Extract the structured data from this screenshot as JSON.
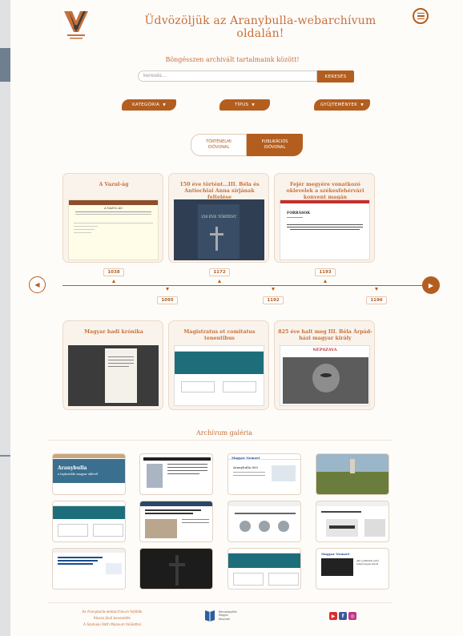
{
  "header": {
    "welcome": "Üdvözöljük az Aranybulla-webarchívum oldalán!"
  },
  "search": {
    "prompt": "Böngésszen archivált tartalmaink között!",
    "placeholder": "keresés...",
    "button_label": "KERESÉS"
  },
  "filters": [
    {
      "label": "KATEGÓRIA"
    },
    {
      "label": "TÍPUS"
    },
    {
      "label": "GYŰJTEMÉNYEK"
    }
  ],
  "timeline_toggle": {
    "option_a_line1": "TÖRTÉNELMI",
    "option_a_line2": "IDŐVONAL",
    "option_b_line1": "PUBLIKÁCIÓS",
    "option_b_line2": "IDŐVONAL",
    "active": "PUBLIKÁCIÓS IDŐVONAL"
  },
  "timeline": {
    "top_cards": [
      {
        "title": "A Vazul-ág",
        "year": "1038"
      },
      {
        "title": "150 éve történt...III. Béla és Antiochiai Anna sírjának feltelése",
        "year": "1172"
      },
      {
        "title": "Fejér megyére vonatkozó oklevelek a székesfehérvári konvent magán",
        "year": "1193"
      }
    ],
    "bottom_cards": [
      {
        "title": "Magyar hadi krónika",
        "year": "1095"
      },
      {
        "title": "Magistratus et comitatus tenentibus",
        "year": "1192"
      },
      {
        "title": "825 éve halt meg III. Béla Árpád-házi magyar király",
        "year": "1196"
      }
    ],
    "thumb_texts": {
      "vazul_head": "A VAZUL-ÁG",
      "book_line1": "150 ÉVE TÖRTÉNT",
      "forrasok": "FORRÁSOK",
      "nepszava": "NÉPSZAVA"
    }
  },
  "gallery": {
    "title": "Archívum galéria",
    "card_texts": {
      "ag1": "Aranybulla",
      "ag1_sub": "a legkorábbi magyar oklevél",
      "ag3": "Aranybulla 800",
      "ag_vh": "Magyar Nemzet",
      "ag12": "Magyar Nemzet",
      "ag12_sub": "Aki a külföldi adót lehetőséges látott"
    },
    "items": [
      "gallery-1",
      "gallery-2",
      "gallery-3",
      "gallery-4",
      "gallery-5",
      "gallery-6",
      "gallery-7",
      "gallery-8",
      "gallery-9",
      "gallery-10",
      "gallery-11",
      "gallery-12"
    ]
  },
  "footer": {
    "line1": "Az Aranybulla-webarchívum fejlődik",
    "line2": "Klassz Jövő bevezetés",
    "line3": "A Szolnoki Ráth Múzeum felülettel",
    "partner_name_1": "Nemzetgyűlés",
    "partner_name_2": "Magyar",
    "partner_name_3": "Könyvtár"
  },
  "colors": {
    "accent": "#b35e1f",
    "accent_light": "#c6703a",
    "card_bg": "#faf3ec"
  },
  "icons": [
    "menu-icon",
    "chevron-left-icon",
    "chevron-right-icon",
    "youtube-icon",
    "facebook-icon",
    "instagram-icon"
  ]
}
